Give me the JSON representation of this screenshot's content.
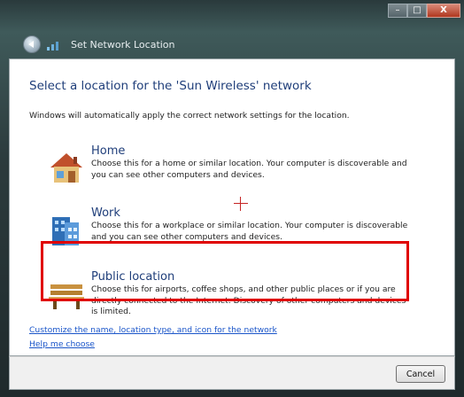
{
  "window": {
    "title": "Set Network Location",
    "controls": {
      "minimize": "–",
      "maximize": "□",
      "close": "X"
    }
  },
  "main": {
    "heading": "Select a location for the 'Sun Wireless' network",
    "subtext": "Windows will automatically apply the correct network settings for the location.",
    "options": [
      {
        "title": "Home",
        "description": "Choose this for a home or similar location. Your computer is discoverable and you can see other computers and devices.",
        "icon": "home-icon"
      },
      {
        "title": "Work",
        "description": "Choose this for a workplace or similar location. Your computer is discoverable and you can see other computers and devices.",
        "icon": "work-icon"
      },
      {
        "title": "Public location",
        "description": "Choose this for airports, coffee shops, and other public places or if you are directly connected to the Internet. Discovery of other computers and devices is limited.",
        "icon": "bench-icon"
      }
    ],
    "links": {
      "customize": "Customize the name, location type, and icon for the network",
      "help": "Help me choose"
    }
  },
  "footer": {
    "cancel_label": "Cancel"
  },
  "colors": {
    "highlight": "#e00000",
    "heading": "#1f3e7a",
    "link": "#1a55c9"
  }
}
